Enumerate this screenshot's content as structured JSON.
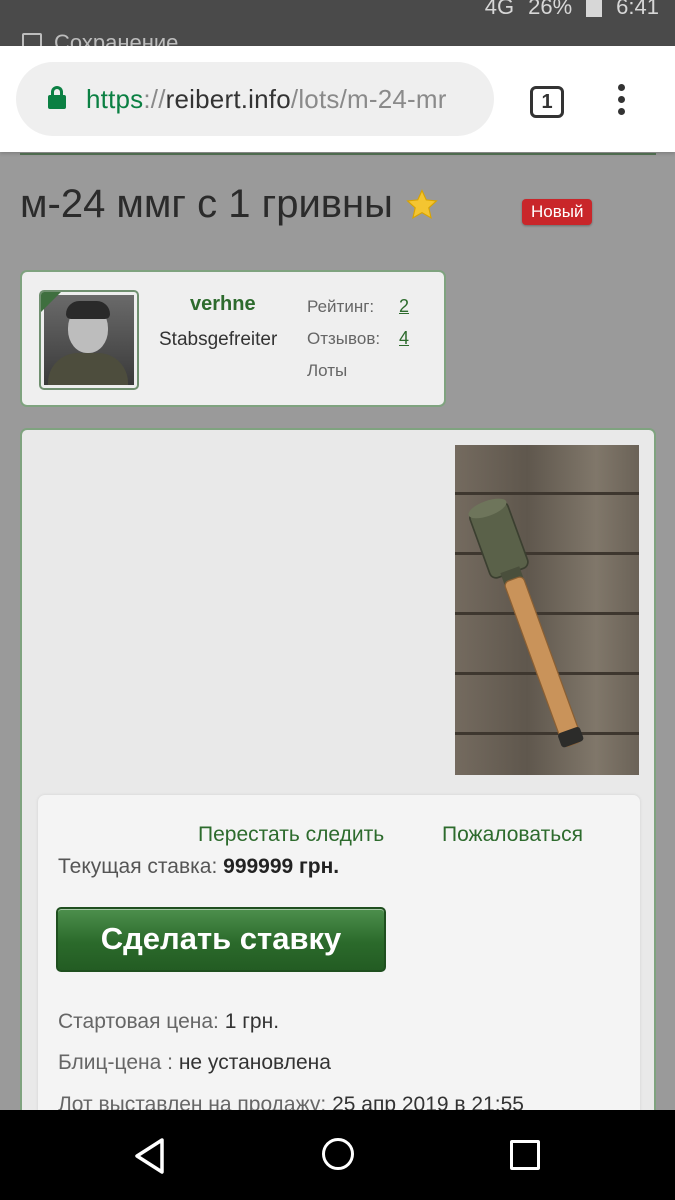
{
  "status_bar": {
    "underlay_text": "Сохранение",
    "network": "4G",
    "battery": "26%",
    "time": "6:41"
  },
  "browser": {
    "url_scheme": "https",
    "url_sep": "://",
    "url_host": "reibert.info",
    "url_path": "/lots/m-24-mr",
    "tab_count": "1"
  },
  "lot": {
    "title": "м-24 ммг с 1 гривны",
    "badge": "Новый"
  },
  "seller": {
    "username": "verhne",
    "rank": "Stabsgefreiter",
    "rating_label": "Рейтинг:",
    "rating_value": "2",
    "reviews_label": "Отзывов:",
    "reviews_value": "4",
    "lots_label": "Лоты"
  },
  "bid": {
    "unwatch_link": "Перестать следить",
    "report_link": "Пожаловаться",
    "current_label": "Текущая ставка:",
    "current_value": "999999 грн.",
    "button": "Сделать ставку",
    "start_label": "Стартовая цена:",
    "start_value": "1 грн.",
    "blitz_label": "Блиц-цена :",
    "blitz_value": "не установлена",
    "listed_label": "Лот выставлен на продажу:",
    "listed_value": "25 апр 2019 в 21:55"
  },
  "colors": {
    "accent": "#2d6b2d",
    "badge": "#c9262a",
    "secure": "#0b8043"
  }
}
